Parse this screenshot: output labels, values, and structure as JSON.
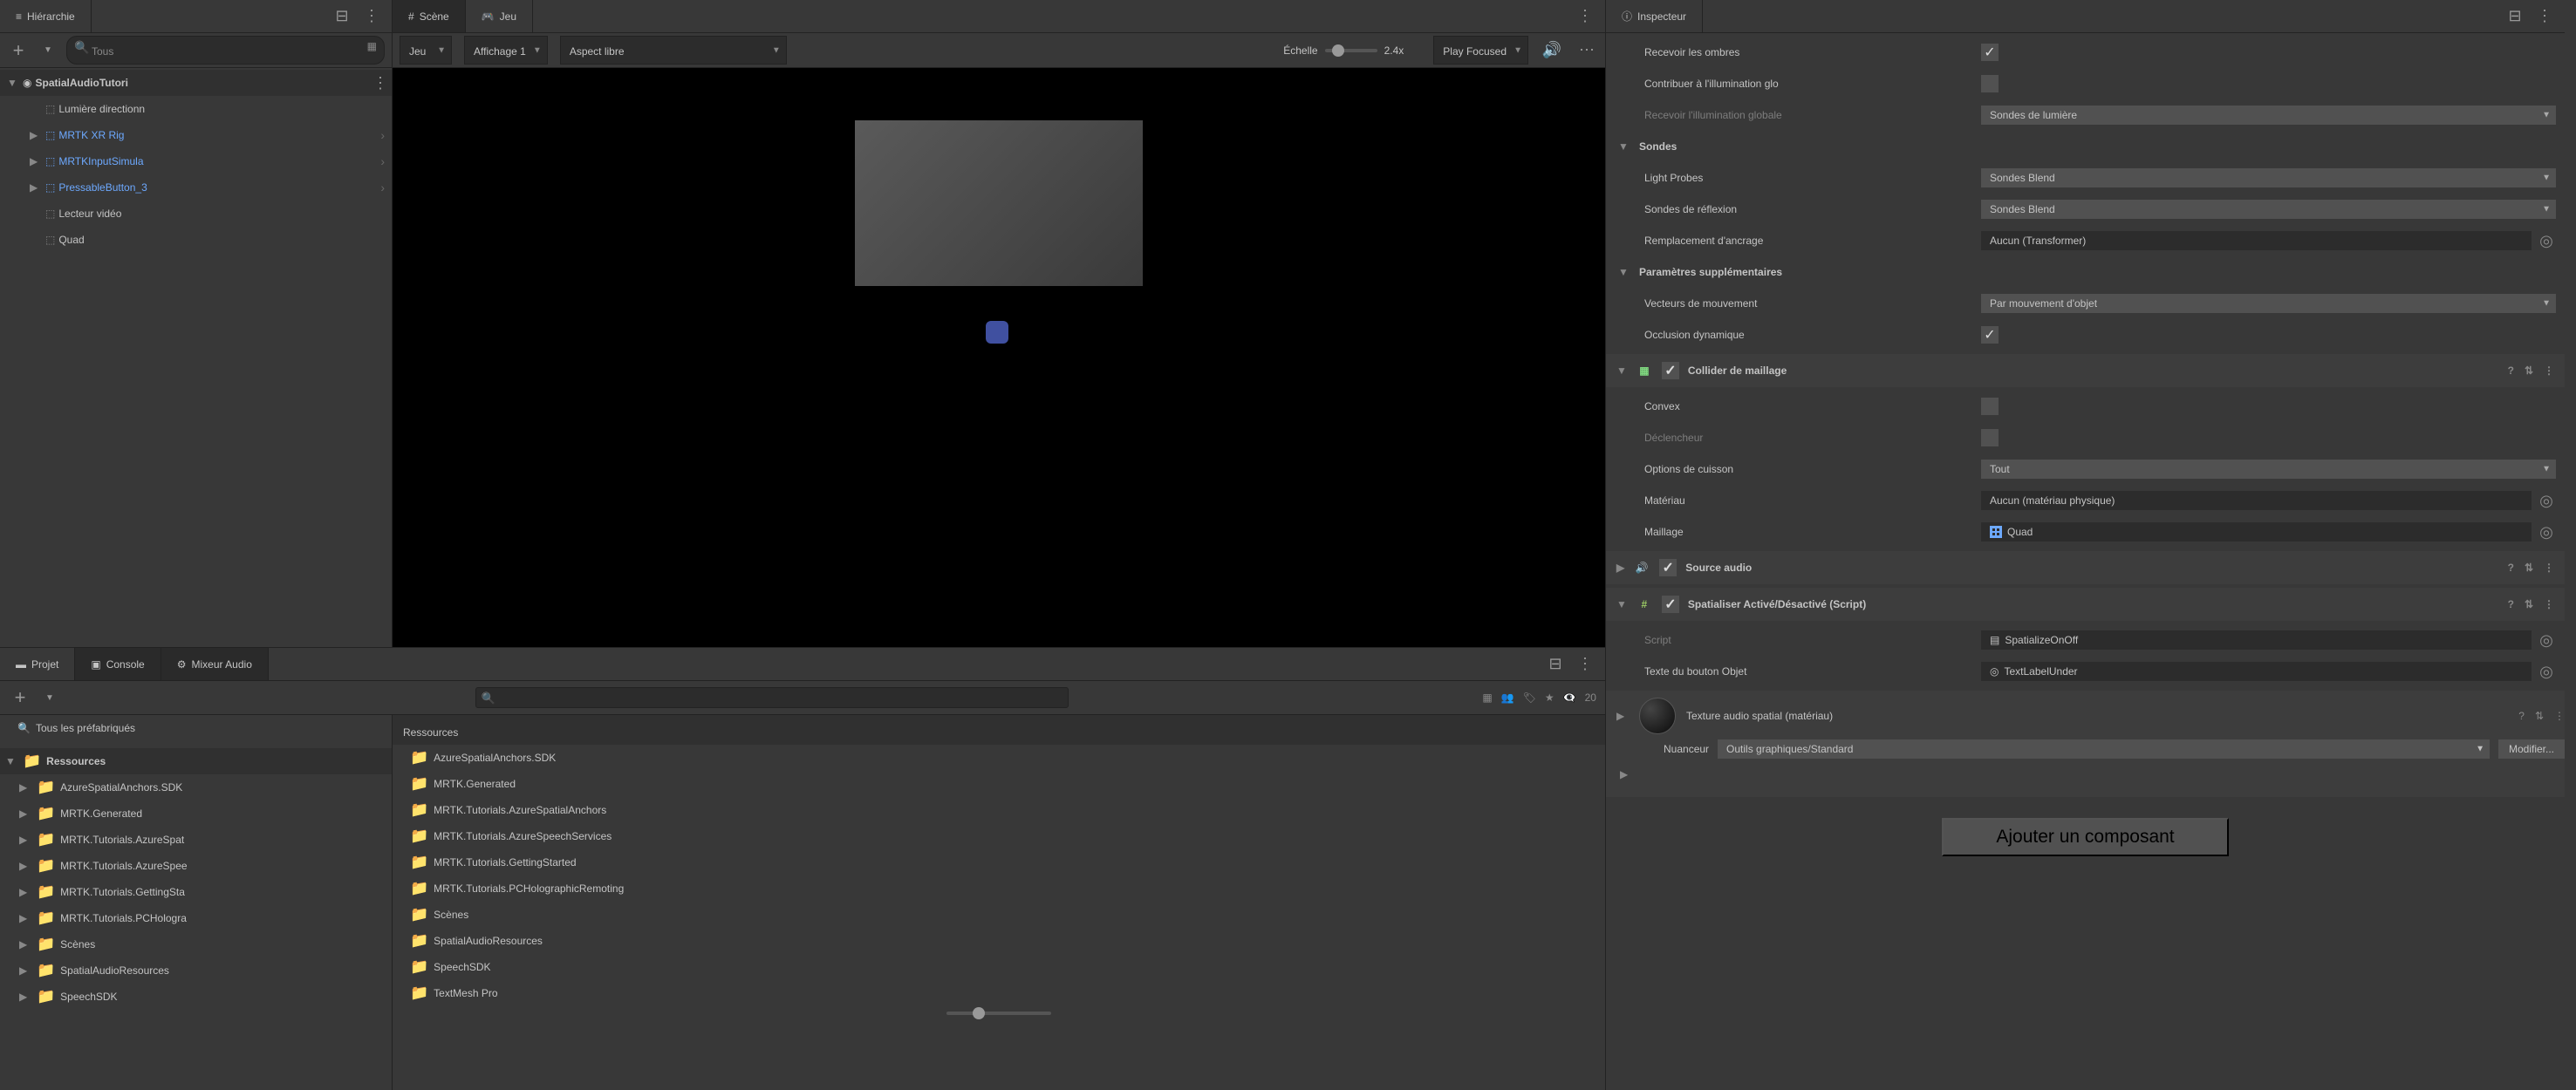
{
  "hierarchy": {
    "tab": "Hiérarchie",
    "search_placeholder": "Tous",
    "scene": "SpatialAudioTutori",
    "items": [
      {
        "label": "Lumière directionn",
        "prefab": false,
        "expandable": false
      },
      {
        "label": "MRTK XR Rig",
        "prefab": true,
        "expandable": true
      },
      {
        "label": "MRTKInputSimula",
        "prefab": true,
        "expandable": true
      },
      {
        "label": "PressableButton_3",
        "prefab": true,
        "expandable": true
      },
      {
        "label": "Lecteur vidéo",
        "prefab": false,
        "expandable": false
      },
      {
        "label": "Quad",
        "prefab": false,
        "expandable": false
      }
    ]
  },
  "center_tabs": {
    "scene": "Scène",
    "game": "Jeu"
  },
  "game_toolbar": {
    "mode": "Jeu",
    "display": "Affichage 1",
    "aspect": "Aspect libre",
    "scale_label": "Échelle",
    "scale_value": "2.4x",
    "play_focus": "Play Focused"
  },
  "project_tabs": {
    "project": "Projet",
    "console": "Console",
    "mixer": "Mixeur Audio"
  },
  "project": {
    "prefab_search": "Tous les préfabriqués",
    "root": "Ressources",
    "hidden_count": "20",
    "tree": [
      "AzureSpatialAnchors.SDK",
      "MRTK.Generated",
      "MRTK.Tutorials.AzureSpat",
      "MRTK.Tutorials.AzureSpee",
      "MRTK.Tutorials.GettingSta",
      "MRTK.Tutorials.PCHologra",
      "Scènes",
      "SpatialAudioResources",
      "SpeechSDK"
    ],
    "list_header": "Ressources",
    "list": [
      "AzureSpatialAnchors.SDK",
      "MRTK.Generated",
      "MRTK.Tutorials.AzureSpatialAnchors",
      "MRTK.Tutorials.AzureSpeechServices",
      "MRTK.Tutorials.GettingStarted",
      "MRTK.Tutorials.PCHolographicRemoting",
      "Scènes",
      "SpatialAudioResources",
      "SpeechSDK",
      "TextMesh Pro"
    ]
  },
  "inspector": {
    "tab": "Inspecteur",
    "truncated_rows": [
      {
        "label": "Recevoir les ombres",
        "type": "check",
        "checked": true,
        "dim": false
      },
      {
        "label": "Contribuer à l'illumination glo",
        "type": "check",
        "checked": false,
        "dim": false
      },
      {
        "label": "Recevoir l'illumination globale",
        "type": "dropdown",
        "value": "Sondes de lumière",
        "dim": true
      }
    ],
    "probes": {
      "header": "Sondes",
      "rows": [
        {
          "label": "Light Probes",
          "type": "dropdown",
          "value": "Sondes Blend"
        },
        {
          "label": "Sondes de réflexion",
          "type": "dropdown",
          "value": "Sondes Blend"
        },
        {
          "label": "Remplacement d'ancrage",
          "type": "object",
          "value": "Aucun (Transformer)"
        }
      ]
    },
    "additional": {
      "header": "Paramètres supplémentaires",
      "rows": [
        {
          "label": "Vecteurs de mouvement",
          "type": "dropdown",
          "value": "Par mouvement d'objet"
        },
        {
          "label": "Occlusion dynamique",
          "type": "check",
          "checked": true
        }
      ]
    },
    "mesh_collider": {
      "header": "Collider de maillage",
      "rows": [
        {
          "label": "Convex",
          "type": "check",
          "checked": false,
          "dim": false
        },
        {
          "label": "Déclencheur",
          "type": "check",
          "checked": false,
          "dim": true
        },
        {
          "label": "Options de cuisson",
          "type": "dropdown",
          "value": "Tout"
        },
        {
          "label": "Matériau",
          "type": "object",
          "value": "Aucun (matériau physique)"
        },
        {
          "label": "Maillage",
          "type": "object_mesh",
          "value": "Quad"
        }
      ]
    },
    "audio_source": {
      "header": "Source audio"
    },
    "spatialize": {
      "header": "Spatialiser Activé/Désactivé (Script)",
      "rows": [
        {
          "label": "Script",
          "type": "object_script",
          "value": "SpatializeOnOff",
          "dim": true
        },
        {
          "label": "Texte du bouton Objet",
          "type": "object_ref",
          "value": "TextLabelUnder"
        }
      ]
    },
    "material": {
      "name": "Texture audio spatial (matériau)",
      "shader_label": "Nuanceur",
      "shader_value": "Outils graphiques/Standard",
      "modify": "Modifier..."
    },
    "add_component": "Ajouter un composant"
  }
}
